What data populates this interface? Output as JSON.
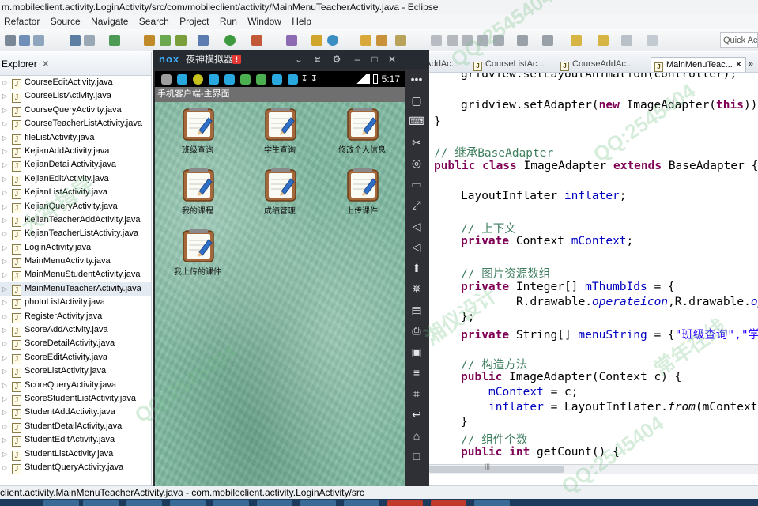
{
  "window": {
    "title": "m.mobileclient.activity.LoginActivity/src/com/mobileclient/activity/MainMenuTeacherActivity.java - Eclipse"
  },
  "menubar": [
    "Refactor",
    "Source",
    "Navigate",
    "Search",
    "Project",
    "Run",
    "Window",
    "Help"
  ],
  "toolbar": {
    "quick_access": "Quick Access"
  },
  "explorer": {
    "tab_label": "Explorer",
    "close_glyph": "✕",
    "files": [
      "CourseEditActivity.java",
      "CourseListActivity.java",
      "CourseQueryActivity.java",
      "CourseTeacherListActivity.java",
      "fileListActivity.java",
      "KejianAddActivity.java",
      "KejianDetailActivity.java",
      "KejianEditActivity.java",
      "KejianListActivity.java",
      "KejianQueryActivity.java",
      "KejianTeacherAddActivity.java",
      "KejianTeacherListActivity.java",
      "LoginActivity.java",
      "MainMenuActivity.java",
      "MainMenuStudentActivity.java",
      "MainMenuTeacherActivity.java",
      "photoListActivity.java",
      "RegisterActivity.java",
      "ScoreAddActivity.java",
      "ScoreDetailActivity.java",
      "ScoreEditActivity.java",
      "ScoreListActivity.java",
      "ScoreQueryActivity.java",
      "ScoreStudentListActivity.java",
      "StudentAddActivity.java",
      "StudentDetailActivity.java",
      "StudentEditActivity.java",
      "StudentListActivity.java",
      "StudentQueryActivity.java"
    ],
    "selected_file": "MainMenuTeacherActivity.java"
  },
  "editor": {
    "tabs": [
      {
        "label": "ejianAddAc..."
      },
      {
        "label": "CourseListAc..."
      },
      {
        "label": "CourseAddAc..."
      },
      {
        "label": "MainMenuTeac...",
        "close": "✕"
      }
    ],
    "overflow_label": "»",
    "code": {
      "l1": "gridview.setLayoutAnimation(controller);",
      "l2a": "gridview.setAdapter(",
      "l2b": "new",
      "l2c": " ImageAdapter(",
      "l2d": "this",
      "l2e": "))",
      "l3": "}",
      "l4": "// 继承BaseAdapter",
      "l5a": "public class",
      "l5b": " ImageAdapter ",
      "l5c": "extends",
      "l5d": " BaseAdapter {",
      "l6a": "LayoutInflater ",
      "l6b": "inflater",
      "l6c": ";",
      "l7": "// 上下文",
      "l8a": "private",
      "l8b": " Context ",
      "l8c": "mContext",
      "l8d": ";",
      "l9": "// 图片资源数组",
      "l10a": "private",
      "l10b": " Integer[] ",
      "l10c": "mThumbIds",
      "l10d": " = {",
      "l11a": "R.drawable.",
      "l11b": "operateicon",
      "l11c": ",R.drawable.",
      "l11d": "op",
      "l12": "};",
      "l13a": "private",
      "l13b": " String[] ",
      "l13c": "menuString",
      "l13d": " = {",
      "l13e": "\"班级查询\",\"学生",
      "l14": "// 构造方法",
      "l15a": "public",
      "l15b": " ImageAdapter(Context c) {",
      "l16a": "mContext",
      "l16b": " = c;",
      "l17a": "inflater",
      "l17b": " = LayoutInflater.",
      "l17c": "from",
      "l17d": "(mContext",
      "l18": "}",
      "l19": "// 组件个数",
      "l20a": "public int",
      "l20b": " getCount() {"
    },
    "hscroll_grip": "|||"
  },
  "statusbar": {
    "text": "client.activity.MainMenuTeacherActivity.java - com.mobileclient.activity.LoginActivity/src"
  },
  "emulator": {
    "logo": "nox",
    "name": "夜神模拟器",
    "badge": "!",
    "controls": [
      "⌄",
      "⯏",
      "⚙",
      "–",
      "□",
      "✕"
    ],
    "status_time": "5:17",
    "status_sys": "↧ ↧",
    "app_title": "手机客户端-主界面",
    "menu_items": [
      "班级查询",
      "学生查询",
      "修改个人信息",
      "我的课程",
      "成绩管理",
      "上传课件",
      "我上传的课件"
    ],
    "sidebar_icons": [
      "•••",
      "▢",
      "⌨",
      "✂",
      "◎",
      "▭",
      "⤢",
      "◁",
      "◁",
      "⬆",
      "✵",
      "▤",
      "⎙",
      "▣",
      "≡",
      "⌗",
      "↩",
      "⌂",
      "□"
    ]
  },
  "watermark": [
    "QQ:2545404",
    "常年在线",
    "大神指导",
    "湘仪设计"
  ]
}
